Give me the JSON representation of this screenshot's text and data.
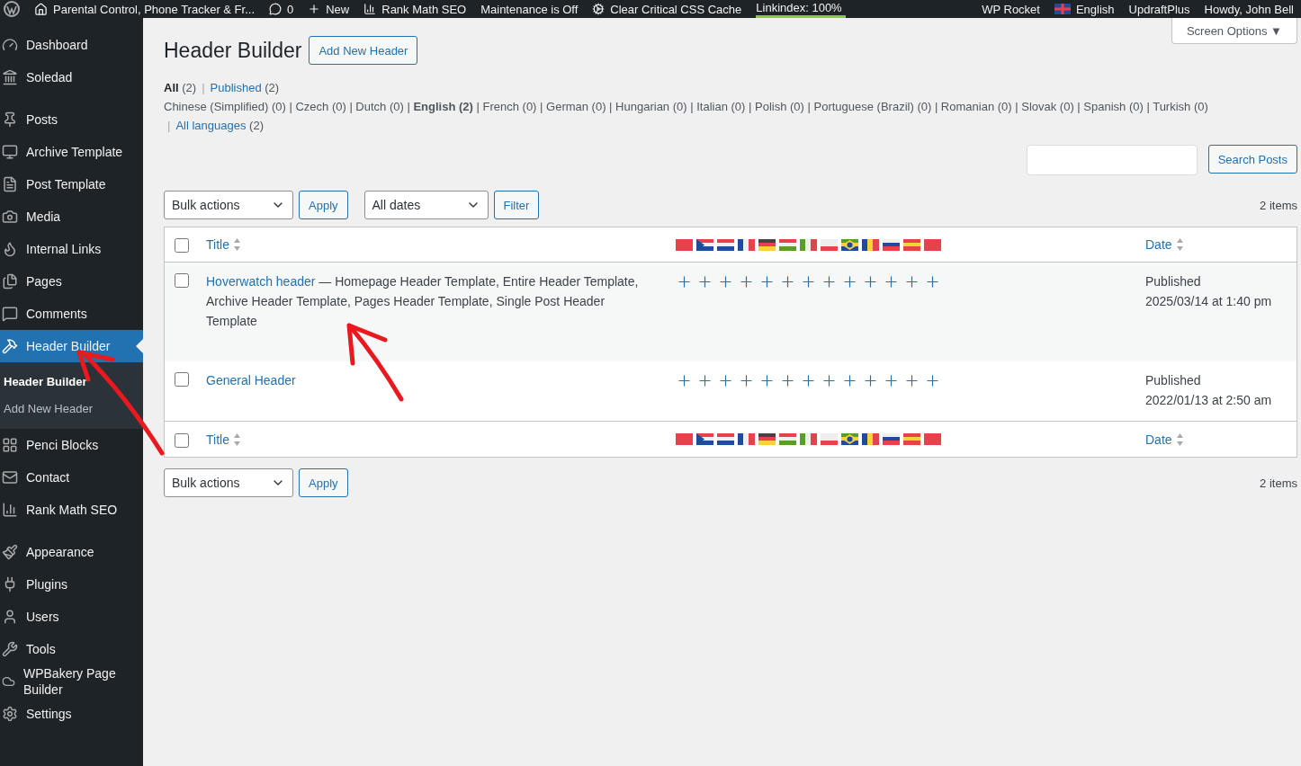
{
  "admin_bar": {
    "items": [
      {
        "kind": "site",
        "label": "Parental Control, Phone Tracker & Fr..."
      },
      {
        "kind": "comments",
        "label": "0"
      },
      {
        "kind": "new",
        "label": "New"
      },
      {
        "kind": "seo",
        "label": "Rank Math SEO"
      },
      {
        "kind": "text",
        "label": "Maintenance is Off"
      },
      {
        "kind": "gear",
        "label": "Clear Critical CSS Cache"
      },
      {
        "kind": "meter",
        "label": "Linkindex: 100%",
        "level": 1
      },
      {
        "kind": "text",
        "label": "WP Rocket"
      },
      {
        "kind": "lang",
        "label": "English"
      },
      {
        "kind": "text",
        "label": "UpdraftPlus"
      },
      {
        "kind": "text",
        "label": "Howdy, John Bell"
      }
    ]
  },
  "sidebar": {
    "groups": [
      [
        {
          "label": "Dashboard",
          "selected": false
        },
        {
          "label": "Soledad",
          "selected": false
        }
      ],
      [
        {
          "label": "Posts",
          "selected": false
        },
        {
          "label": "Archive Template",
          "selected": false
        },
        {
          "label": "Post Template",
          "selected": false
        },
        {
          "label": "Media",
          "selected": false
        },
        {
          "label": "Internal Links",
          "selected": false
        },
        {
          "label": "Pages",
          "selected": false
        },
        {
          "label": "Comments",
          "selected": false
        },
        {
          "label": "Header Builder",
          "selected": true,
          "children": [
            {
              "label": "Header Builder",
              "selected": true
            },
            {
              "label": "Add New Header",
              "selected": false
            }
          ]
        },
        {
          "label": "Penci Blocks",
          "selected": false
        },
        {
          "label": "Contact",
          "selected": false
        },
        {
          "label": "Rank Math SEO",
          "selected": false
        }
      ],
      [
        {
          "label": "Appearance",
          "selected": false
        },
        {
          "label": "Plugins",
          "selected": false
        },
        {
          "label": "Users",
          "selected": false
        },
        {
          "label": "Tools",
          "selected": false
        },
        {
          "label": "WPBakery Page Builder",
          "selected": false
        },
        {
          "label": "Settings",
          "selected": false
        }
      ]
    ]
  },
  "page": {
    "title": "Header Builder",
    "add_button": "Add New Header",
    "screen_options": "Screen Options ▼"
  },
  "status_links": [
    {
      "label": "All",
      "count": "(2)",
      "selected": true
    },
    {
      "separator": "|",
      "label": "Published",
      "count": "(2)",
      "selected": false
    }
  ],
  "language_links": "Chinese (Simplified) (0) | Czech (0) | Dutch (0) | **English (2)** | French (0) | German (0) | Hungarian (0) | Italian (0) | Polish (0) | Portuguese (Brazil) (0) | Romanian (0) | Slovak (0) | Spanish (0) | Turkish (0)",
  "all_languages": {
    "separator": "|",
    "label": "All languages",
    "count": "(2)"
  },
  "search_button": "Search Posts",
  "top_actions": {
    "bulk": "Bulk actions",
    "apply": "Apply",
    "dates": "All dates",
    "filter": "Filter",
    "count": "2 items"
  },
  "table": {
    "header": {
      "title": "Title",
      "date": "Date",
      "checked": false
    },
    "rows": [
      {
        "title": "Hoverwatch header",
        "description": " — Homepage Header Template, Entire Header Template, Archive Header Template, Pages Header Template, Single Post Header Template",
        "status": "Published",
        "date": "2025/03/14 at 1:40 pm",
        "checked": false
      },
      {
        "title": "General Header",
        "status": "Published",
        "date": "2022/01/13 at 2:50 am",
        "checked": false
      }
    ],
    "footer": {
      "title": "Title",
      "date": "Date",
      "checked": false
    }
  },
  "bottom_actions": {
    "bulk": "Bulk actions",
    "apply": "Apply",
    "count": "2 items"
  }
}
